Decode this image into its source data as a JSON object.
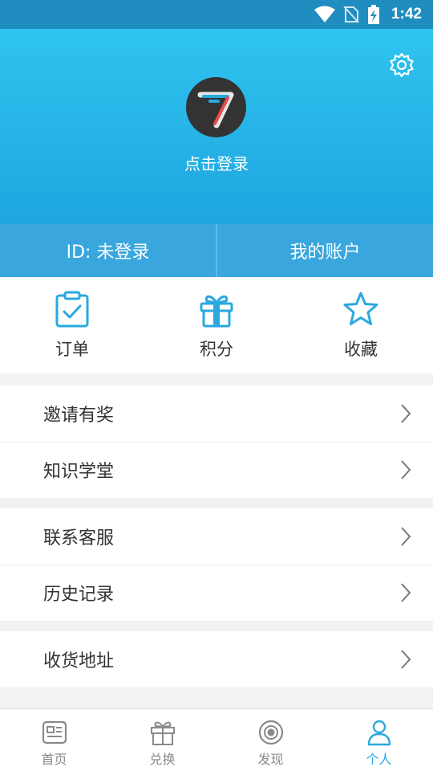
{
  "status_bar": {
    "time": "1:42",
    "icons": [
      "wifi-icon",
      "no-sim-icon",
      "battery-charging-icon"
    ]
  },
  "header": {
    "login_prompt": "点击登录",
    "settings_icon": "gear-icon",
    "avatar_icon": "app-logo-7"
  },
  "account": {
    "id_label": "ID: 未登录",
    "my_account": "我的账户"
  },
  "quick_entries": [
    {
      "label": "订单",
      "icon": "clipboard-check-icon"
    },
    {
      "label": "积分",
      "icon": "gift-icon"
    },
    {
      "label": "收藏",
      "icon": "star-icon"
    }
  ],
  "menu_groups": [
    [
      {
        "label": "邀请有奖"
      },
      {
        "label": "知识学堂"
      }
    ],
    [
      {
        "label": "联系客服"
      },
      {
        "label": "历史记录"
      }
    ],
    [
      {
        "label": "收货地址"
      }
    ]
  ],
  "bottom_nav": [
    {
      "label": "首页",
      "icon": "news-card-icon",
      "active": false
    },
    {
      "label": "兑换",
      "icon": "gift-icon",
      "active": false
    },
    {
      "label": "发现",
      "icon": "eye-circle-icon",
      "active": false
    },
    {
      "label": "个人",
      "icon": "person-icon",
      "active": true
    }
  ],
  "colors": {
    "accent": "#2aa8e0",
    "header_top": "#2fc4ef",
    "header_bottom": "#1fa6df",
    "strip": "#3aa6de",
    "status_bar": "#1f8dbf"
  }
}
